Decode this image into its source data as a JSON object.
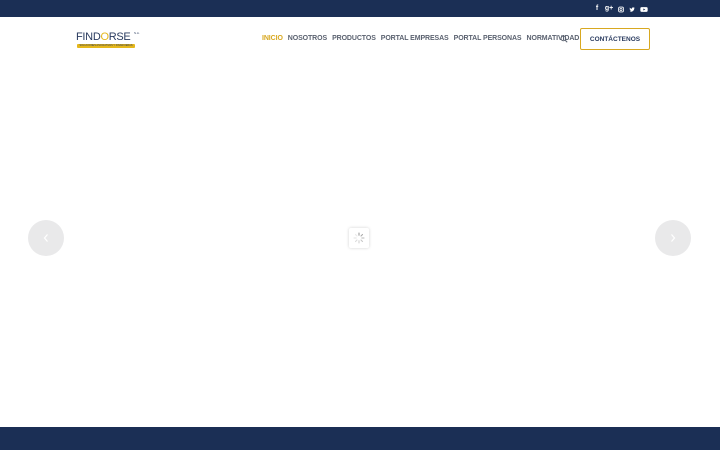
{
  "colors": {
    "navy": "#1b2f55",
    "accent": "#d8a820",
    "nav_text": "#5b6270",
    "arrow_bg": "#e9e9ea"
  },
  "topbar": {
    "social": [
      {
        "icon": "facebook-icon",
        "glyph": "f"
      },
      {
        "icon": "google-plus-icon",
        "glyph": "g+"
      },
      {
        "icon": "instagram-icon",
        "glyph": ""
      },
      {
        "icon": "twitter-icon",
        "glyph": ""
      },
      {
        "icon": "youtube-icon",
        "glyph": ""
      }
    ]
  },
  "logo": {
    "part1": "FIND",
    "o": "O",
    "part2": "RSE",
    "suffix": "S.A.",
    "tagline": "SOLUCIONES ASOCIATIVAS Y FINANCIERAS"
  },
  "nav": {
    "items": [
      {
        "label": "INICIO",
        "active": true
      },
      {
        "label": "NOSOTROS",
        "active": false
      },
      {
        "label": "PRODUCTOS",
        "active": false
      },
      {
        "label": "PORTAL EMPRESAS",
        "active": false
      },
      {
        "label": "PORTAL PERSONAS",
        "active": false
      },
      {
        "label": "NORMATIVIDAD",
        "active": false
      }
    ],
    "search_icon": "search-icon"
  },
  "cta": {
    "label": "CONTÁCTENOS"
  },
  "slider": {
    "prev_icon": "chevron-left-icon",
    "next_icon": "chevron-right-icon",
    "loader_icon": "spinner-icon"
  }
}
